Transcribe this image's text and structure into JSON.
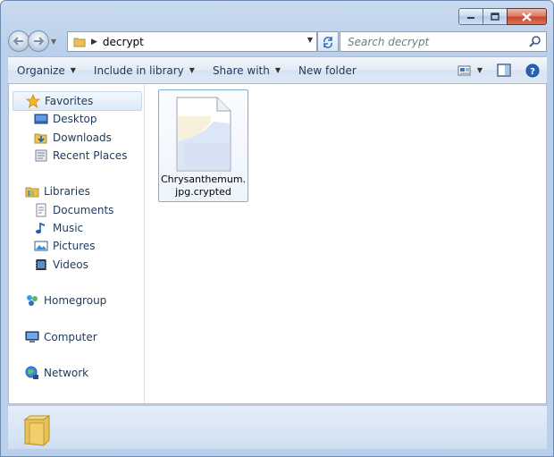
{
  "window": {
    "minimize_icon": "minimize-icon",
    "maximize_icon": "maximize-icon",
    "close_icon": "close-icon"
  },
  "nav": {
    "back_icon": "back-arrow-icon",
    "forward_icon": "forward-arrow-icon",
    "address_path": "decrypt",
    "search_placeholder": "Search decrypt"
  },
  "toolbar": {
    "organize": "Organize",
    "include_in_library": "Include in library",
    "share_with": "Share with",
    "new_folder": "New folder"
  },
  "sidebar": {
    "favorites": "Favorites",
    "desktop": "Desktop",
    "downloads": "Downloads",
    "recent_places": "Recent Places",
    "libraries": "Libraries",
    "documents": "Documents",
    "music": "Music",
    "pictures": "Pictures",
    "videos": "Videos",
    "homegroup": "Homegroup",
    "computer": "Computer",
    "network": "Network"
  },
  "files": [
    {
      "name_line1": "Chrysanthemum.",
      "name_line2": "jpg.crypted"
    }
  ],
  "colors": {
    "accent": "#1e395b",
    "selection": "#dde9f7",
    "close_red": "#c4452c"
  }
}
